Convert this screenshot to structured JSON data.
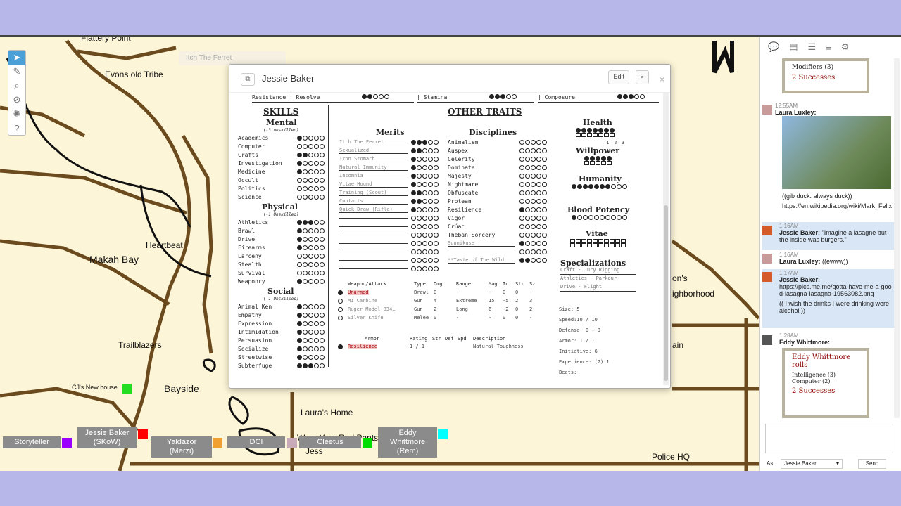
{
  "map": {
    "labels": [
      "Flattery Point",
      "Evons old Tribe",
      "Makah Bay",
      "Heartbeat",
      "Trailblazers",
      "CJ's New house",
      "Bayside",
      "Laura's Home",
      "Wear Your Red Pants",
      "Jess",
      "Police HQ",
      "on's",
      "ighborhood",
      "ain"
    ],
    "faded_label": "Itch The Ferret",
    "tokens": [
      {
        "name": "Storyteller",
        "color": "#9b00ff"
      },
      {
        "name": "Jessie Baker (SKoW)",
        "color": "#ff0000"
      },
      {
        "name": "Yaldazor (Merzi)",
        "color": "#f0a030"
      },
      {
        "name": "DCI",
        "color": "#c8aab8"
      },
      {
        "name": "Cleetus",
        "color": "#00dd00"
      },
      {
        "name": "Eddy Whittmore (Rem)",
        "color": "#00ffff"
      }
    ]
  },
  "window": {
    "title": "Jessie Baker",
    "edit": "Edit",
    "close": "×"
  },
  "sheet": {
    "attributes": [
      {
        "group": "Resistance",
        "name": "Resolve",
        "dots": 2
      },
      {
        "name": "Stamina",
        "dots": 3
      },
      {
        "name": "Composure",
        "dots": 3
      }
    ],
    "skills_title": "SKILLS",
    "other_title": "OTHER TRAITS",
    "mental": {
      "title": "Mental",
      "note": "(-3 unskilled)",
      "items": [
        [
          "Academics",
          1
        ],
        [
          "Computer",
          0
        ],
        [
          "Crafts",
          2
        ],
        [
          "Investigation",
          1
        ],
        [
          "Medicine",
          1
        ],
        [
          "Occult",
          0
        ],
        [
          "Politics",
          0
        ],
        [
          "Science",
          0
        ]
      ]
    },
    "physical": {
      "title": "Physical",
      "note": "(-1 Unskilled)",
      "items": [
        [
          "Athletics",
          3
        ],
        [
          "Brawl",
          1
        ],
        [
          "Drive",
          1
        ],
        [
          "Firearms",
          1
        ],
        [
          "Larceny",
          0
        ],
        [
          "Stealth",
          0
        ],
        [
          "Survival",
          0
        ],
        [
          "Weaponry",
          1
        ]
      ]
    },
    "social": {
      "title": "Social",
      "note": "(-1 Unskilled)",
      "items": [
        [
          "Animal Ken",
          1
        ],
        [
          "Empathy",
          1
        ],
        [
          "Expression",
          1
        ],
        [
          "Intimidation",
          1
        ],
        [
          "Persuasion",
          1
        ],
        [
          "Socialize",
          1
        ],
        [
          "Streetwise",
          1
        ],
        [
          "Subterfuge",
          3
        ]
      ]
    },
    "merits_title": "Merits",
    "merits": [
      [
        "Itch The Ferret",
        3
      ],
      [
        "Sexualized",
        2
      ],
      [
        "Iron Stomach",
        1
      ],
      [
        "Natural Immunity",
        1
      ],
      [
        "Insomnia",
        1
      ],
      [
        "Vitae Hound",
        1
      ],
      [
        "Training (Scout)",
        2
      ],
      [
        "Contacts",
        2
      ],
      [
        "Quick Draw (Rifle)",
        1
      ],
      [
        "",
        0
      ],
      [
        "",
        0
      ],
      [
        "",
        0
      ],
      [
        "",
        0
      ],
      [
        "",
        0
      ],
      [
        "",
        0
      ],
      [
        "",
        0
      ]
    ],
    "disc_title": "Disciplines",
    "disciplines": [
      [
        "Animalism",
        0
      ],
      [
        "Auspex",
        0
      ],
      [
        "Celerity",
        0
      ],
      [
        "Dominate",
        0
      ],
      [
        "Majesty",
        0
      ],
      [
        "Nightmare",
        0
      ],
      [
        "Obfuscate",
        0
      ],
      [
        "Protean",
        0
      ],
      [
        "Resilience",
        1
      ],
      [
        "Vigor",
        0
      ],
      [
        "Crúac",
        0
      ],
      [
        "Theban Sorcery",
        0
      ],
      [
        "Sunnikuse",
        1
      ],
      [
        "",
        0
      ],
      [
        "**Taste of The Wild",
        2
      ]
    ],
    "health": {
      "title": "Health",
      "dots": 7,
      "mods": "-1 -2 -3"
    },
    "willpower": {
      "title": "Willpower",
      "dots": 5
    },
    "humanity": {
      "title": "Humanity",
      "dots": 7,
      "max": 10
    },
    "blood_potency": {
      "title": "Blood Potency",
      "dots": 1,
      "max": 10
    },
    "vitae": {
      "title": "Vitae"
    },
    "spec_title": "Specializations",
    "specs": [
      "Craft - Jury Rigging",
      "Athletics - Parkour",
      "Drive - Flight"
    ],
    "stats": [
      "Size: 5",
      "Speed:10 / 10",
      "Defense: 0 + 0",
      "Armor: 1 / 1",
      "Initiative: 6",
      "Experience: (7) 1",
      "Beats:"
    ],
    "weapons_head": [
      "Weapon/Attack",
      "Type",
      "Dmg",
      "Range",
      "Mag",
      "Ini",
      "Str",
      "Sz"
    ],
    "weapons": [
      [
        "Unarmed",
        "Brawl",
        "0",
        "-",
        "-",
        "0",
        "0",
        "-"
      ],
      [
        "M1 Carbine",
        "Gun",
        "4",
        "Extreme",
        "15",
        "-5",
        "2",
        "3"
      ],
      [
        "Ruger Model 834L",
        "Gun",
        "2",
        "Long",
        "6",
        "-2",
        "0",
        "2"
      ],
      [
        "Silver Knife",
        "Melee",
        "0",
        "-",
        "-",
        "0",
        "0",
        "-"
      ]
    ],
    "armor_head": [
      "Armor",
      "Rating",
      "Str",
      "Def",
      "Spd",
      "Description"
    ],
    "armor": [
      [
        "Resilience",
        "1 / 1",
        "Natural Toughness"
      ]
    ]
  },
  "chat": {
    "msgs": [
      {
        "top_roll": "Modifiers (3)",
        "top_succ": "2 Successes"
      },
      {
        "time": "12:55AM",
        "who": "Laura Luxley:",
        "text": "((gib duck. always duck))",
        "link": "https://en.wikipedia.org/wiki/Mark_Felix"
      },
      {
        "time": "1:16AM",
        "who": "Jessie Baker:",
        "text": "\"Imagine a lasagne but the inside was burgers.\""
      },
      {
        "time": "1:16AM",
        "who": "Laura Luxley:",
        "text": "((ewww))"
      },
      {
        "time": "1:17AM",
        "who": "Jessie Baker:",
        "text": "https://pics.me.me/gotta-have-me-a-good-lasagna-lasagna-19563082.png",
        "text2": "(( I wish the drinks I were drinking were alcohol ))"
      },
      {
        "time": "1:28AM",
        "who": "Eddy Whittmore:",
        "roll_title": "Eddy Whittmore rolls",
        "l1": "Intelligence (3)",
        "l2": "Computer (2)",
        "succ": "2 Successes"
      }
    ],
    "as_label": "As:",
    "as_value": "Jessie Baker",
    "send": "Send"
  }
}
